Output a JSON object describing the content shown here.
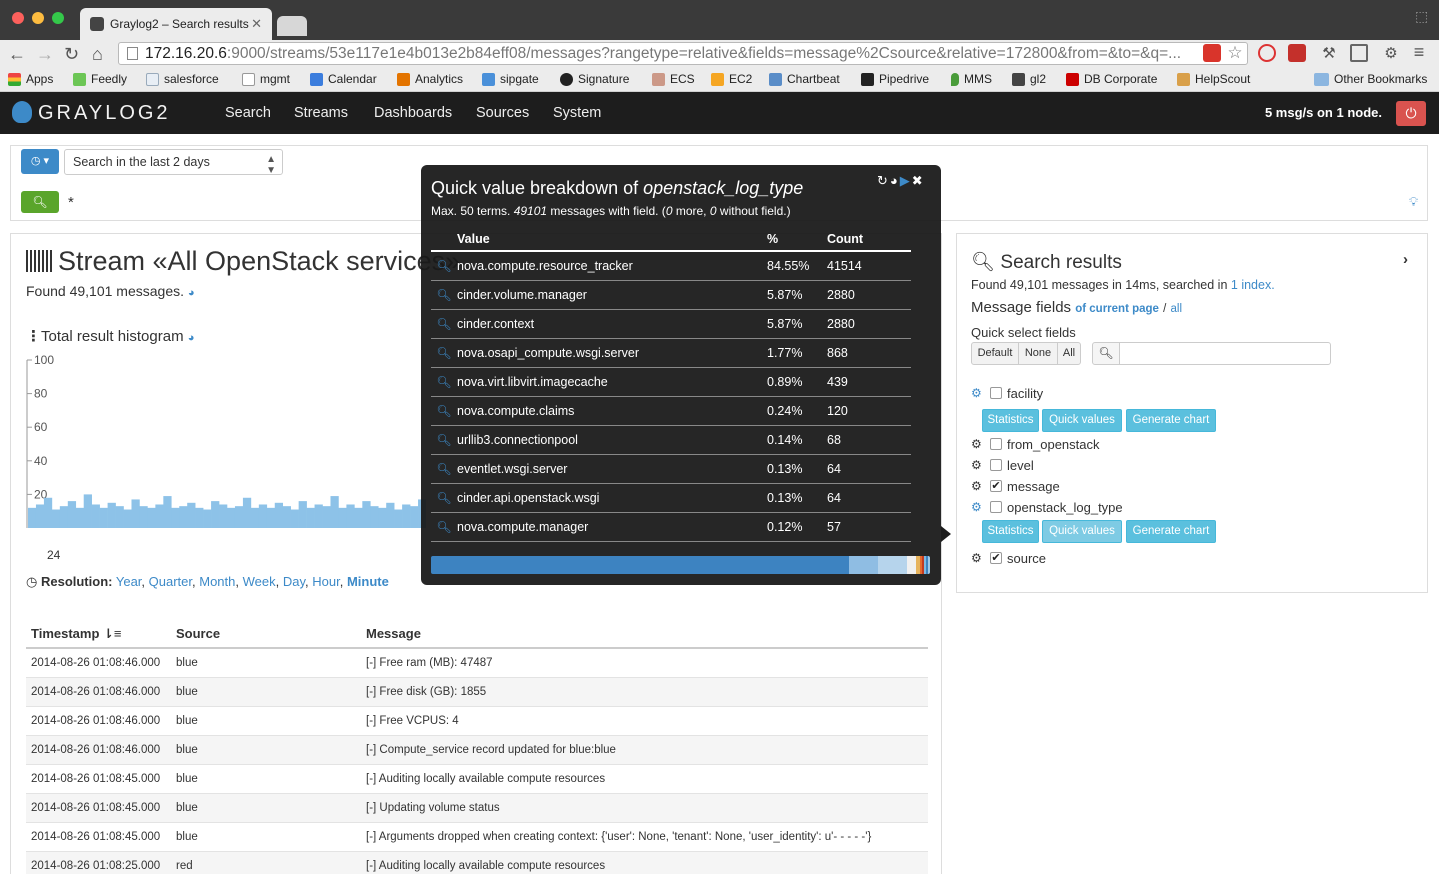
{
  "browser": {
    "tab_title": "Graylog2 – Search results",
    "url_host": "172.16.20.6",
    "url_rest": ":9000/streams/53e117e1e4b013e2b84eff08/messages?rangetype=relative&fields=message%2Csource&relative=172800&from=&to=&q=...",
    "bookmarks": [
      "Apps",
      "Feedly",
      "salesforce",
      "mgmt",
      "Calendar",
      "Analytics",
      "sipgate",
      "Signature",
      "ECS",
      "EC2",
      "Chartbeat",
      "Pipedrive",
      "MMS",
      "gl2",
      "DB Corporate",
      "HelpScout"
    ],
    "other_bookmarks": "Other Bookmarks"
  },
  "navbar": {
    "brand": "GRAYLOG2",
    "items": [
      "Search",
      "Streams",
      "Dashboards",
      "Sources",
      "System"
    ],
    "throughput": "5 msg/s on 1 node."
  },
  "search": {
    "range": "Search in the last 2 days",
    "query": "*"
  },
  "stream": {
    "title": "Stream «All OpenStack services»",
    "found": "Found 49,101 messages.",
    "histogram_title": "Total result histogram",
    "histogram_axis_label": "24",
    "resolution_label": "Resolution:",
    "resolutions": [
      "Year",
      "Quarter",
      "Month",
      "Week",
      "Day",
      "Hour",
      "Minute"
    ],
    "active_resolution": "Minute"
  },
  "chart_data": {
    "type": "bar",
    "yticks": [
      20,
      40,
      60,
      80,
      100
    ],
    "ylim": [
      0,
      100
    ],
    "values": [
      12,
      14,
      18,
      11,
      13,
      16,
      12,
      20,
      14,
      12,
      15,
      13,
      11,
      17,
      13,
      12,
      14,
      19,
      12,
      13,
      15,
      12,
      11,
      16,
      14,
      12,
      13,
      18,
      12,
      14,
      12,
      15,
      13,
      11,
      16,
      12,
      14,
      13,
      19,
      12,
      14,
      12,
      16,
      13,
      12,
      15,
      11,
      14,
      13,
      17
    ]
  },
  "table": {
    "headers": [
      "Timestamp",
      "Source",
      "Message"
    ],
    "rows": [
      [
        "2014-08-26 01:08:46.000",
        "blue",
        "[-] Free ram (MB): 47487"
      ],
      [
        "2014-08-26 01:08:46.000",
        "blue",
        "[-] Free disk (GB): 1855"
      ],
      [
        "2014-08-26 01:08:46.000",
        "blue",
        "[-] Free VCPUS: 4"
      ],
      [
        "2014-08-26 01:08:46.000",
        "blue",
        "[-] Compute_service record updated for blue:blue"
      ],
      [
        "2014-08-26 01:08:45.000",
        "blue",
        "[-] Auditing locally available compute resources"
      ],
      [
        "2014-08-26 01:08:45.000",
        "blue",
        "[-] Updating volume status"
      ],
      [
        "2014-08-26 01:08:45.000",
        "blue",
        "[-] Arguments dropped when creating context: {'user': None, 'tenant': None, 'user_identity': u'- - - - -'}"
      ],
      [
        "2014-08-26 01:08:25.000",
        "red",
        "[-] Auditing locally available compute resources"
      ]
    ]
  },
  "results": {
    "title": "Search results",
    "found_prefix": "Found 49,101 messages in 14ms, searched in",
    "found_link": "1 index.",
    "fields_title": "Message fields",
    "fields_current": "of current page",
    "fields_sep": "/",
    "fields_all": "all",
    "quick_select_title": "Quick select fields",
    "quick_buttons": [
      "Default",
      "None",
      "All"
    ],
    "fields": [
      {
        "name": "facility",
        "checked": false
      },
      {
        "name": "from_openstack",
        "checked": false
      },
      {
        "name": "level",
        "checked": false
      },
      {
        "name": "message",
        "checked": true
      },
      {
        "name": "openstack_log_type",
        "checked": false
      },
      {
        "name": "source",
        "checked": true
      }
    ],
    "field_buttons": [
      "Statistics",
      "Quick values",
      "Generate chart"
    ]
  },
  "popover": {
    "title_prefix": "Quick value breakdown of",
    "field": "openstack_log_type",
    "sub_prefix": "Max. 50 terms.",
    "sub_count": "49101",
    "sub_mid": "messages with field. (",
    "sub_more": "0",
    "sub_more_text": "more,",
    "sub_without": "0",
    "sub_without_text": "without field.)",
    "headers": [
      "Value",
      "%",
      "Count"
    ],
    "rows": [
      [
        "nova.compute.resource_tracker",
        "84.55%",
        "41514"
      ],
      [
        "cinder.volume.manager",
        "5.87%",
        "2880"
      ],
      [
        "cinder.context",
        "5.87%",
        "2880"
      ],
      [
        "nova.osapi_compute.wsgi.server",
        "1.77%",
        "868"
      ],
      [
        "nova.virt.libvirt.imagecache",
        "0.89%",
        "439"
      ],
      [
        "nova.compute.claims",
        "0.24%",
        "120"
      ],
      [
        "urllib3.connectionpool",
        "0.14%",
        "68"
      ],
      [
        "eventlet.wsgi.server",
        "0.13%",
        "64"
      ],
      [
        "cinder.api.openstack.wsgi",
        "0.13%",
        "64"
      ],
      [
        "nova.compute.manager",
        "0.12%",
        "57"
      ]
    ],
    "bar_shares": [
      84.55,
      5.87,
      5.87,
      1.77,
      0.89,
      0.24,
      0.14,
      0.13,
      0.13,
      0.12
    ],
    "bar_colors": [
      "#3d83c1",
      "#8fbde3",
      "#b6d4ec",
      "#f0f0f0",
      "#e6b35c",
      "#e56a2e",
      "#c23b22",
      "#7db8e2",
      "#3d83c1",
      "#9fc8e8"
    ]
  }
}
